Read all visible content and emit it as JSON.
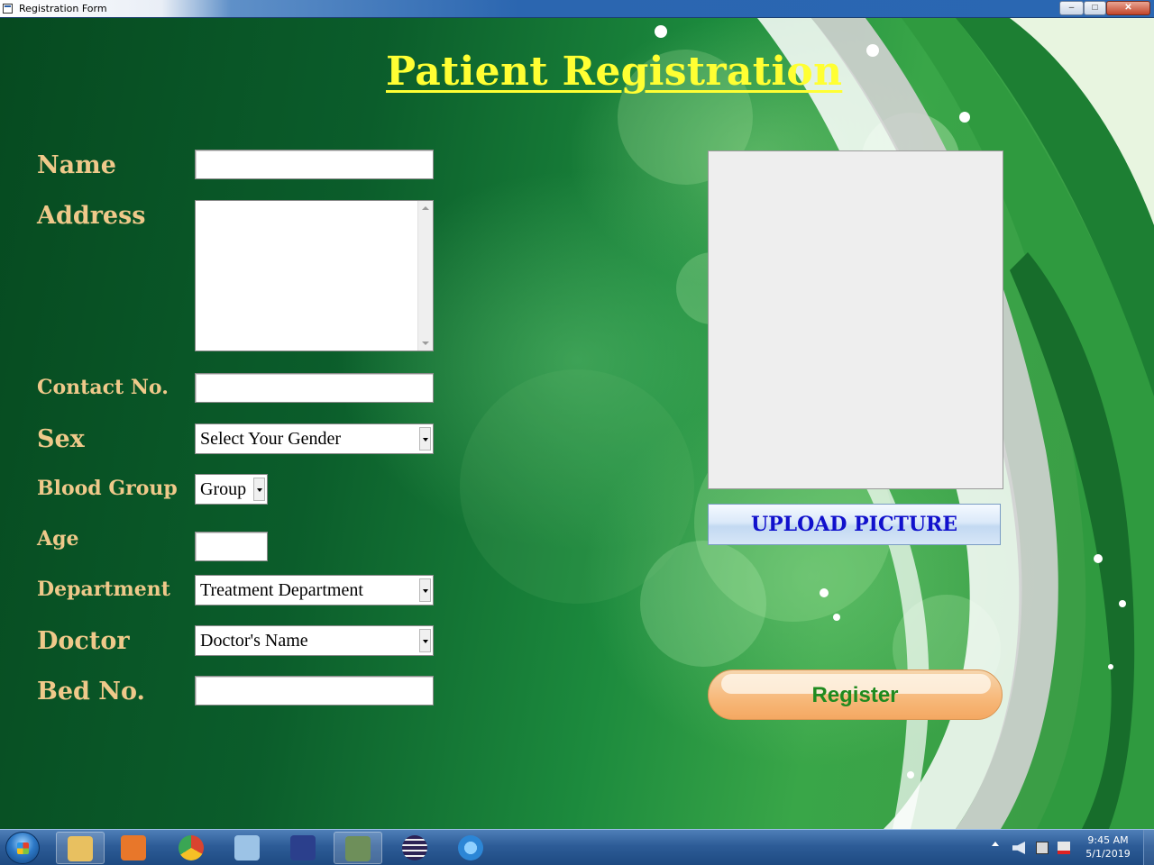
{
  "window": {
    "title": "Registration Form",
    "minimize_glyph": "–",
    "maximize_glyph": "□",
    "close_glyph": "✕"
  },
  "form": {
    "heading": "Patient Registration",
    "labels": {
      "name": "Name",
      "address": "Address",
      "contact": "Contact No.",
      "sex": "Sex",
      "blood_group": "Blood Group",
      "age": "Age",
      "department": "Department",
      "doctor": "Doctor",
      "bed": "Bed No."
    },
    "values": {
      "name": "",
      "address": "",
      "contact": "",
      "age": "",
      "bed": ""
    },
    "selects": {
      "sex": "Select Your Gender",
      "blood_group": "Group",
      "department": "Treatment Department",
      "doctor": "Doctor's Name"
    },
    "upload_label": "UPLOAD PICTURE",
    "register_label": "Register"
  },
  "colors": {
    "heading": "#ffff33",
    "label": "#efc98a",
    "upload_text": "#1010cc",
    "register_text": "#1f8a1f"
  },
  "taskbar": {
    "start_icon": "windows-logo-icon",
    "pinned": [
      {
        "name": "file-explorer-icon",
        "color": "#e8c060"
      },
      {
        "name": "media-player-icon",
        "color": "#e8772a"
      },
      {
        "name": "chrome-icon",
        "color": "#d9442f"
      },
      {
        "name": "notepad-icon",
        "color": "#9cc3e6"
      },
      {
        "name": "devcpp-icon",
        "color": "#2b3f8c"
      },
      {
        "name": "registration-app-icon",
        "color": "#6e8f5a"
      },
      {
        "name": "eclipse-icon",
        "color": "#2c2255"
      },
      {
        "name": "internet-explorer-icon",
        "color": "#2c86d6"
      }
    ],
    "tray_icons": [
      "volume-icon",
      "network-icon",
      "flag-icon"
    ],
    "time": "9:45 AM",
    "date": "5/1/2019"
  }
}
